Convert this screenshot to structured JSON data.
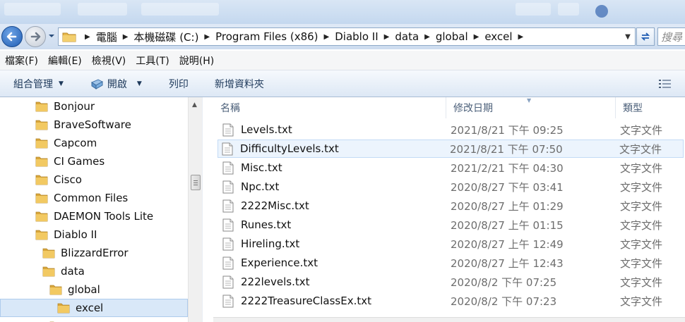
{
  "window": {
    "title_strip_blurred": true
  },
  "address": {
    "crumbs": [
      "電腦",
      "本機磁碟 (C:)",
      "Program Files (x86)",
      "Diablo II",
      "data",
      "global",
      "excel"
    ],
    "search_placeholder": "搜尋"
  },
  "menu": {
    "items": [
      "檔案(F)",
      "編輯(E)",
      "檢視(V)",
      "工具(T)",
      "說明(H)"
    ]
  },
  "toolbar": {
    "organize": "組合管理",
    "open": "開啟",
    "print": "列印",
    "new_folder": "新增資料夾"
  },
  "tree": {
    "items": [
      {
        "label": "Bonjour",
        "level": 0
      },
      {
        "label": "BraveSoftware",
        "level": 0
      },
      {
        "label": "Capcom",
        "level": 0
      },
      {
        "label": "CI Games",
        "level": 0
      },
      {
        "label": "Cisco",
        "level": 0
      },
      {
        "label": "Common Files",
        "level": 0
      },
      {
        "label": "DAEMON Tools Lite",
        "level": 0
      },
      {
        "label": "Diablo II",
        "level": 0
      },
      {
        "label": "BlizzardError",
        "level": 1
      },
      {
        "label": "data",
        "level": 1
      },
      {
        "label": "global",
        "level": 2
      },
      {
        "label": "excel",
        "level": 3,
        "selected": true
      }
    ]
  },
  "columns": {
    "name": "名稱",
    "date": "修改日期",
    "type": "類型"
  },
  "files": [
    {
      "name": "Levels.txt",
      "date": "2021/8/21 下午 09:25",
      "type": "文字文件"
    },
    {
      "name": "DifficultyLevels.txt",
      "date": "2021/8/21 下午 07:50",
      "type": "文字文件",
      "selected": true
    },
    {
      "name": "Misc.txt",
      "date": "2021/2/21 下午 04:30",
      "type": "文字文件"
    },
    {
      "name": "Npc.txt",
      "date": "2020/8/27 下午 03:41",
      "type": "文字文件"
    },
    {
      "name": "2222Misc.txt",
      "date": "2020/8/27 上午 01:29",
      "type": "文字文件"
    },
    {
      "name": "Runes.txt",
      "date": "2020/8/27 上午 01:15",
      "type": "文字文件"
    },
    {
      "name": "Hireling.txt",
      "date": "2020/8/27 上午 12:49",
      "type": "文字文件"
    },
    {
      "name": "Experience.txt",
      "date": "2020/8/27 上午 12:43",
      "type": "文字文件"
    },
    {
      "name": "222levels.txt",
      "date": "2020/8/2 下午 07:25",
      "type": "文字文件"
    },
    {
      "name": "2222TreasureClassEx.txt",
      "date": "2020/8/2 下午 07:23",
      "type": "文字文件"
    }
  ],
  "colors": {
    "selection": "#d9e8f8",
    "folder": "#e8b84a",
    "accent": "#1e5cb3"
  }
}
